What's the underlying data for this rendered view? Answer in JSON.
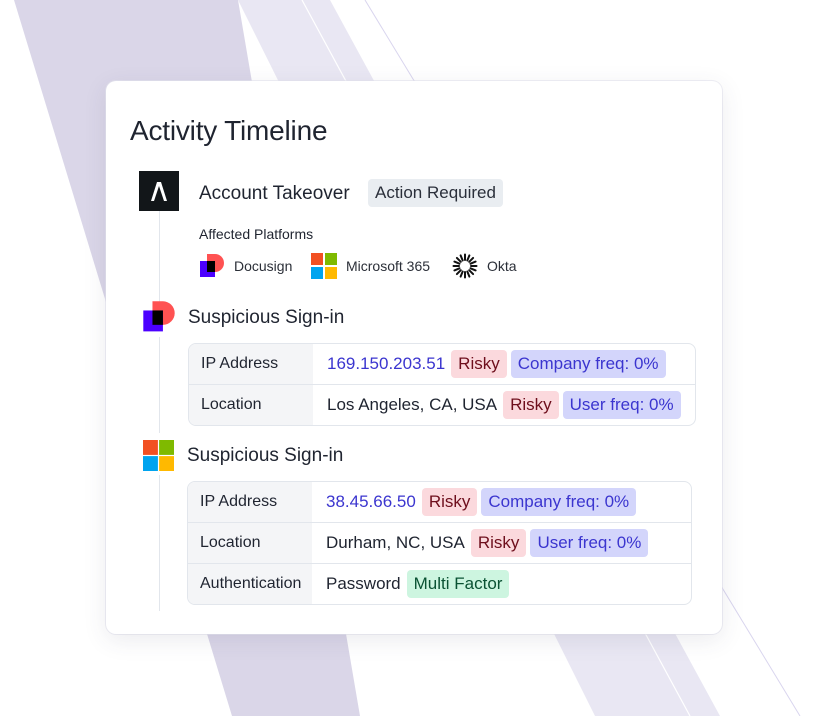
{
  "title": "Activity Timeline",
  "colors": {
    "accent_blue": "#3b35cf",
    "risky_bg": "#fbd9dd",
    "freq_bg": "#d3d5fb",
    "mfa_bg": "#cdf5e0",
    "bg_lavender": "#dad6e8"
  },
  "event_takeover": {
    "icon": "abnormal-logo-icon",
    "title": "Account Takeover",
    "badge": "Action Required",
    "platforms_label": "Affected Platforms",
    "platforms": [
      {
        "name": "Docusign",
        "icon": "docusign-icon"
      },
      {
        "name": "Microsoft 365",
        "icon": "microsoft-icon"
      },
      {
        "name": "Okta",
        "icon": "okta-icon"
      }
    ]
  },
  "event_docusign": {
    "icon": "docusign-icon",
    "title": "Suspicious Sign-in",
    "rows": [
      {
        "key": "IP Address",
        "value": "169.150.203.51",
        "badges": [
          "Risky",
          "Company freq: 0%"
        ]
      },
      {
        "key": "Location",
        "value": "Los Angeles, CA, USA",
        "badges": [
          "Risky",
          "User freq: 0%"
        ]
      }
    ]
  },
  "event_microsoft": {
    "icon": "microsoft-icon",
    "title": "Suspicious Sign-in",
    "rows": [
      {
        "key": "IP Address",
        "value": "38.45.66.50",
        "badges": [
          "Risky",
          "Company freq: 0%"
        ]
      },
      {
        "key": "Location",
        "value": "Durham, NC, USA",
        "badges": [
          "Risky",
          "User freq: 0%"
        ]
      },
      {
        "key": "Authentication",
        "value": "Password",
        "badges": [
          "Multi Factor"
        ]
      }
    ]
  }
}
